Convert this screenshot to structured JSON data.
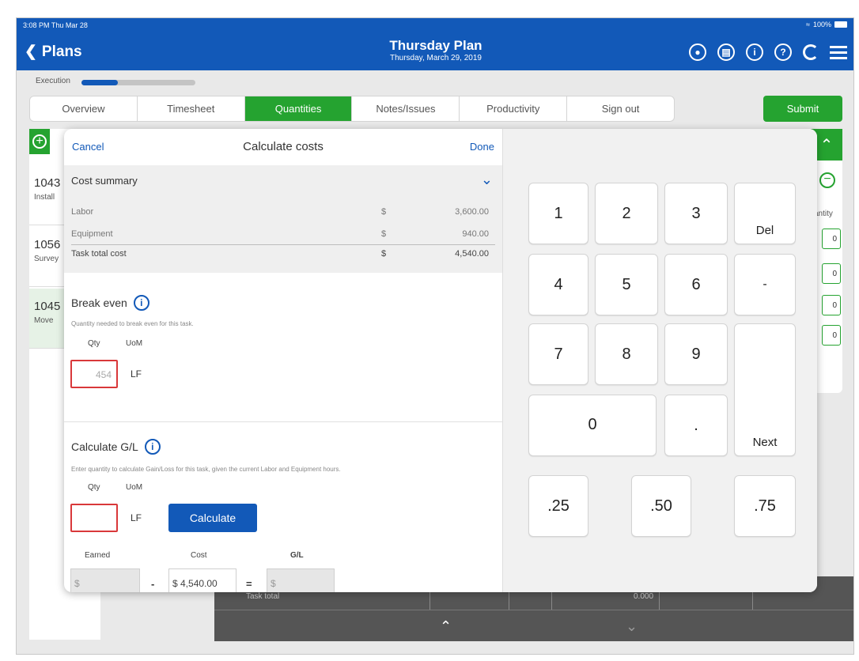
{
  "status": {
    "time": "3:08 PM Thu Mar 28",
    "battery": "100%"
  },
  "header": {
    "back_label": "Plans",
    "title": "Thursday Plan",
    "subtitle": "Thursday, March 29, 2019",
    "icons": [
      "chat-icon",
      "hardhat-icon",
      "info-icon",
      "help-icon",
      "sync-icon",
      "menu-icon"
    ]
  },
  "execution": {
    "label": "Execution",
    "progress": 0.32
  },
  "tabs": [
    "Overview",
    "Timesheet",
    "Quantities",
    "Notes/Issues",
    "Productivity",
    "Sign out"
  ],
  "active_tab": "Quantities",
  "submit_label": "Submit",
  "bg_list": [
    {
      "num": "1043",
      "desc": "Install"
    },
    {
      "num": "1056",
      "desc": "Survey"
    },
    {
      "num": "1045",
      "desc": "Move"
    }
  ],
  "bg_right": {
    "header": "antity",
    "values": [
      "0",
      "0",
      "0",
      "0"
    ]
  },
  "bottom": {
    "label": "Task total",
    "value": "0.000"
  },
  "modal": {
    "cancel": "Cancel",
    "title": "Calculate costs",
    "done": "Done",
    "summary": {
      "title": "Cost summary",
      "rows": [
        {
          "label": "Labor",
          "currency": "$",
          "amount": "3,600.00"
        },
        {
          "label": "Equipment",
          "currency": "$",
          "amount": "940.00"
        },
        {
          "label": "Task total cost",
          "currency": "$",
          "amount": "4,540.00"
        }
      ]
    },
    "break_even": {
      "title": "Break even",
      "desc": "Quantity needed to break even for this task.",
      "qty_label": "Qty",
      "uom_label": "UoM",
      "qty_value": "454",
      "uom_value": "LF"
    },
    "calc_gl": {
      "title": "Calculate G/L",
      "desc": "Enter quantity to calculate Gain/Loss for this task, given the current Labor and Equipment hours.",
      "qty_label": "Qty",
      "uom_label": "UoM",
      "qty_value": "",
      "uom_value": "LF",
      "button": "Calculate",
      "earned_label": "Earned",
      "cost_label": "Cost",
      "gl_label": "G/L",
      "earned_value": "$",
      "cost_value": "$  4,540.00",
      "gl_value": "$",
      "minus": "-",
      "equals": "="
    },
    "keypad": [
      "1",
      "2",
      "3",
      "Del",
      "4",
      "5",
      "6",
      "-",
      "7",
      "8",
      "9",
      "0",
      ".",
      "Next",
      ".25",
      ".50",
      ".75"
    ]
  },
  "colors": {
    "brand_blue": "#1259b8",
    "accent_green": "#25a330",
    "error_red": "#d9383a"
  }
}
